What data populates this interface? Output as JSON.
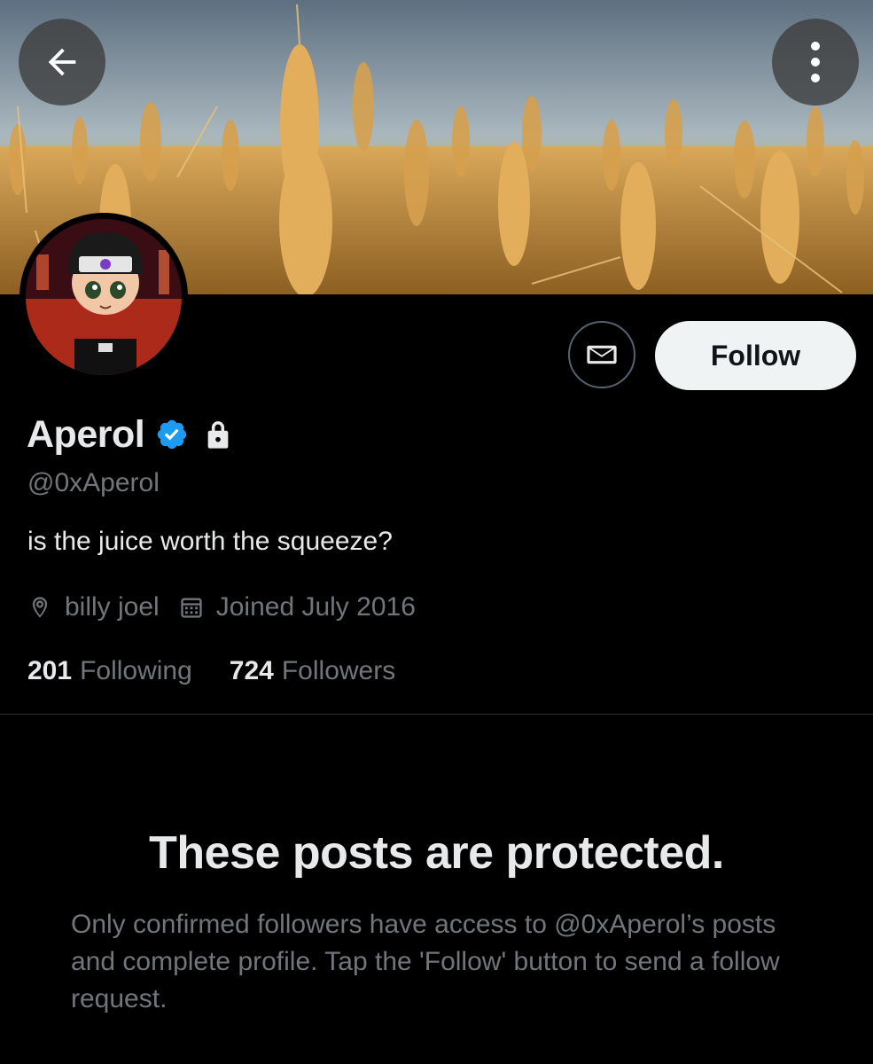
{
  "header": {
    "back_icon": "arrow-left-icon",
    "more_icon": "more-vertical-icon",
    "banner": "wheat-field-photo"
  },
  "profile": {
    "display_name": "Aperol",
    "handle": "@0xAperol",
    "bio": "is the juice worth the squeeze?",
    "location": "billy joel",
    "joined": "Joined July 2016",
    "verified_color": "#1d9bf0",
    "following_count": "201",
    "following_label": "Following",
    "followers_count": "724",
    "followers_label": "Followers"
  },
  "actions": {
    "message_icon": "envelope-icon",
    "follow_label": "Follow"
  },
  "protected": {
    "title": "These posts are protected.",
    "body": "Only confirmed followers have access to @0xAperol’s posts and complete profile. Tap the 'Follow' button to send a follow request."
  },
  "colors": {
    "background": "#000000",
    "text_primary": "#e7e9ea",
    "text_secondary": "#71767b",
    "divider": "#2f3336",
    "follow_button_bg": "#eff3f4"
  }
}
